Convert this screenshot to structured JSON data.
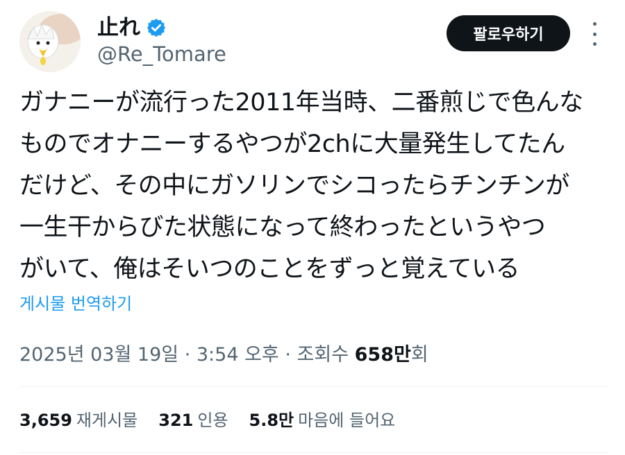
{
  "header": {
    "display_name": "止れ",
    "handle": "@Re_Tomare",
    "follow_label": "팔로우하기"
  },
  "tweet": {
    "lines": [
      "ガナニーが流行った2011年当時、二番煎じで色んな",
      "ものでオナニーするやつが2chに大量発生してたん",
      "だけど、その中にガソリンでシコったらチンチンが",
      "一生干からびた状態になって終わったというやつ",
      "がいて、俺はそいつのことをずっと覚えている"
    ],
    "translate_label": "게시물 번역하기"
  },
  "meta": {
    "date": "2025년 03월 19일",
    "sep1": " · ",
    "time": "3:54 오후",
    "sep2": " · ",
    "views_label": "조회수 ",
    "views_count": "658만",
    "views_suffix": "회"
  },
  "stats": [
    {
      "count": "3,659",
      "label": "재게시물"
    },
    {
      "count": "321",
      "label": "인용"
    },
    {
      "count": "5.8만",
      "label": "마음에 들어요"
    }
  ],
  "colors": {
    "accent": "#1d9bf0",
    "text": "#0f1419",
    "secondary": "#536471"
  }
}
